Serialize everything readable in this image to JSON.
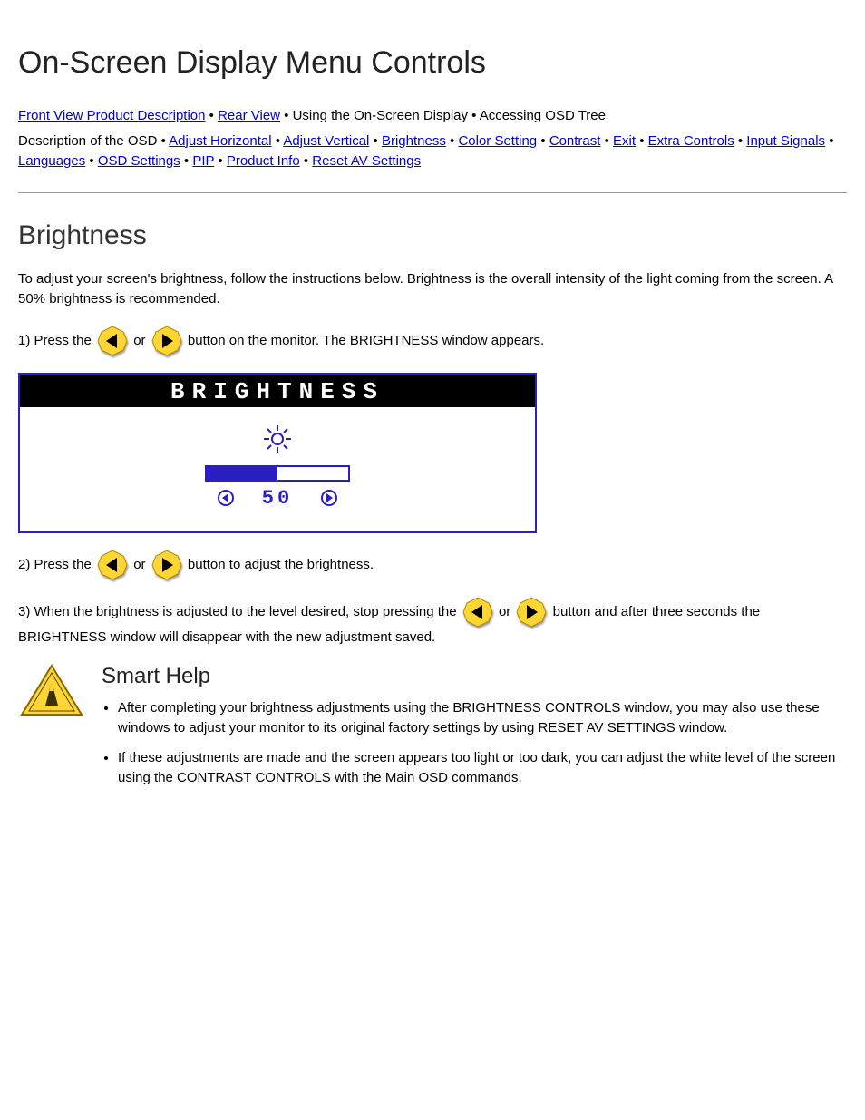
{
  "title": "On-Screen Display Menu Controls",
  "nav_row1": [
    {
      "text": "Front View Product Description",
      "sep": " • "
    },
    {
      "text": "Rear View",
      "sep": " • Using the On-Screen Display • Accessing OSD Tree"
    }
  ],
  "nav_row2_prefix": "Description of the OSD • ",
  "nav_links2": [
    {
      "text": "Adjust Horizontal",
      "sep": " • "
    },
    {
      "text": "Adjust Vertical",
      "sep": " • "
    },
    {
      "text": "Brightness",
      "sep": " • "
    },
    {
      "text": "Color Setting",
      "sep": " • "
    },
    {
      "text": "Contrast",
      "sep": " • "
    },
    {
      "text": "Exit",
      "sep": " • "
    },
    {
      "text": "Extra Controls",
      "sep": " • "
    },
    {
      "text": "Input Signals",
      "sep": " • "
    },
    {
      "text": "Languages",
      "sep": " • "
    },
    {
      "text": "OSD Settings",
      "sep": " • "
    },
    {
      "text": "PIP",
      "sep": " • "
    },
    {
      "text": "Product Info",
      "sep": " • "
    },
    {
      "text": "Reset AV Settings",
      "sep": ""
    }
  ],
  "section_heading": "Brightness",
  "intro_text": "To adjust your screen's brightness, follow the instructions below. Brightness is the overall intensity of the light coming from the screen. A 50% brightness is recommended.",
  "steps": {
    "s1_prefix": "1) Press the ",
    "s1_mid": " or ",
    "s1_suffix": " button on the monitor. The BRIGHTNESS window appears.",
    "s2_prefix": "2) Press the ",
    "s2_mid": " or ",
    "s2_suffix": " button to adjust the brightness.",
    "s3_prefix": "3) When the brightness is adjusted to the level desired, stop pressing the ",
    "s3_mid": " or ",
    "s3_suffix": " button and after three seconds the BRIGHTNESS window will disappear with the new adjustment saved."
  },
  "osd": {
    "title": "BRIGHTNESS",
    "value": "50",
    "fill_pct": 50
  },
  "notes": {
    "heading": "Smart Help",
    "bullet1": "After completing your brightness adjustments using the BRIGHTNESS CONTROLS window, you may also use these windows to adjust your monitor to its original factory settings by using RESET AV SETTINGS window.",
    "bullet2": " If these adjustments are made and the screen appears too light or too dark, you can adjust the white level of the screen using the CONTRAST CONTROLS with the Main OSD commands."
  }
}
